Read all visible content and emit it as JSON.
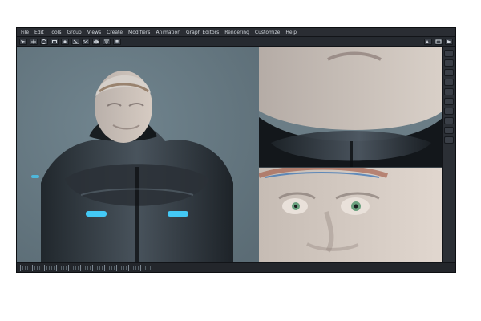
{
  "app": {
    "menu": [
      "File",
      "Edit",
      "Tools",
      "Group",
      "Views",
      "Create",
      "Modifiers",
      "Animation",
      "Graph Editors",
      "Rendering",
      "Customize",
      "Help"
    ],
    "toolbar_icons": [
      "select-icon",
      "move-icon",
      "rotate-icon",
      "scale-icon",
      "snap-icon",
      "angle-snap-icon",
      "percent-snap-icon",
      "mirror-icon",
      "align-icon",
      "layer-icon",
      "render-setup-icon",
      "render-frame-icon",
      "render-icon"
    ],
    "timeline_ticks": 55
  },
  "ui": {
    "viewport_bg": "#6b7d86"
  }
}
